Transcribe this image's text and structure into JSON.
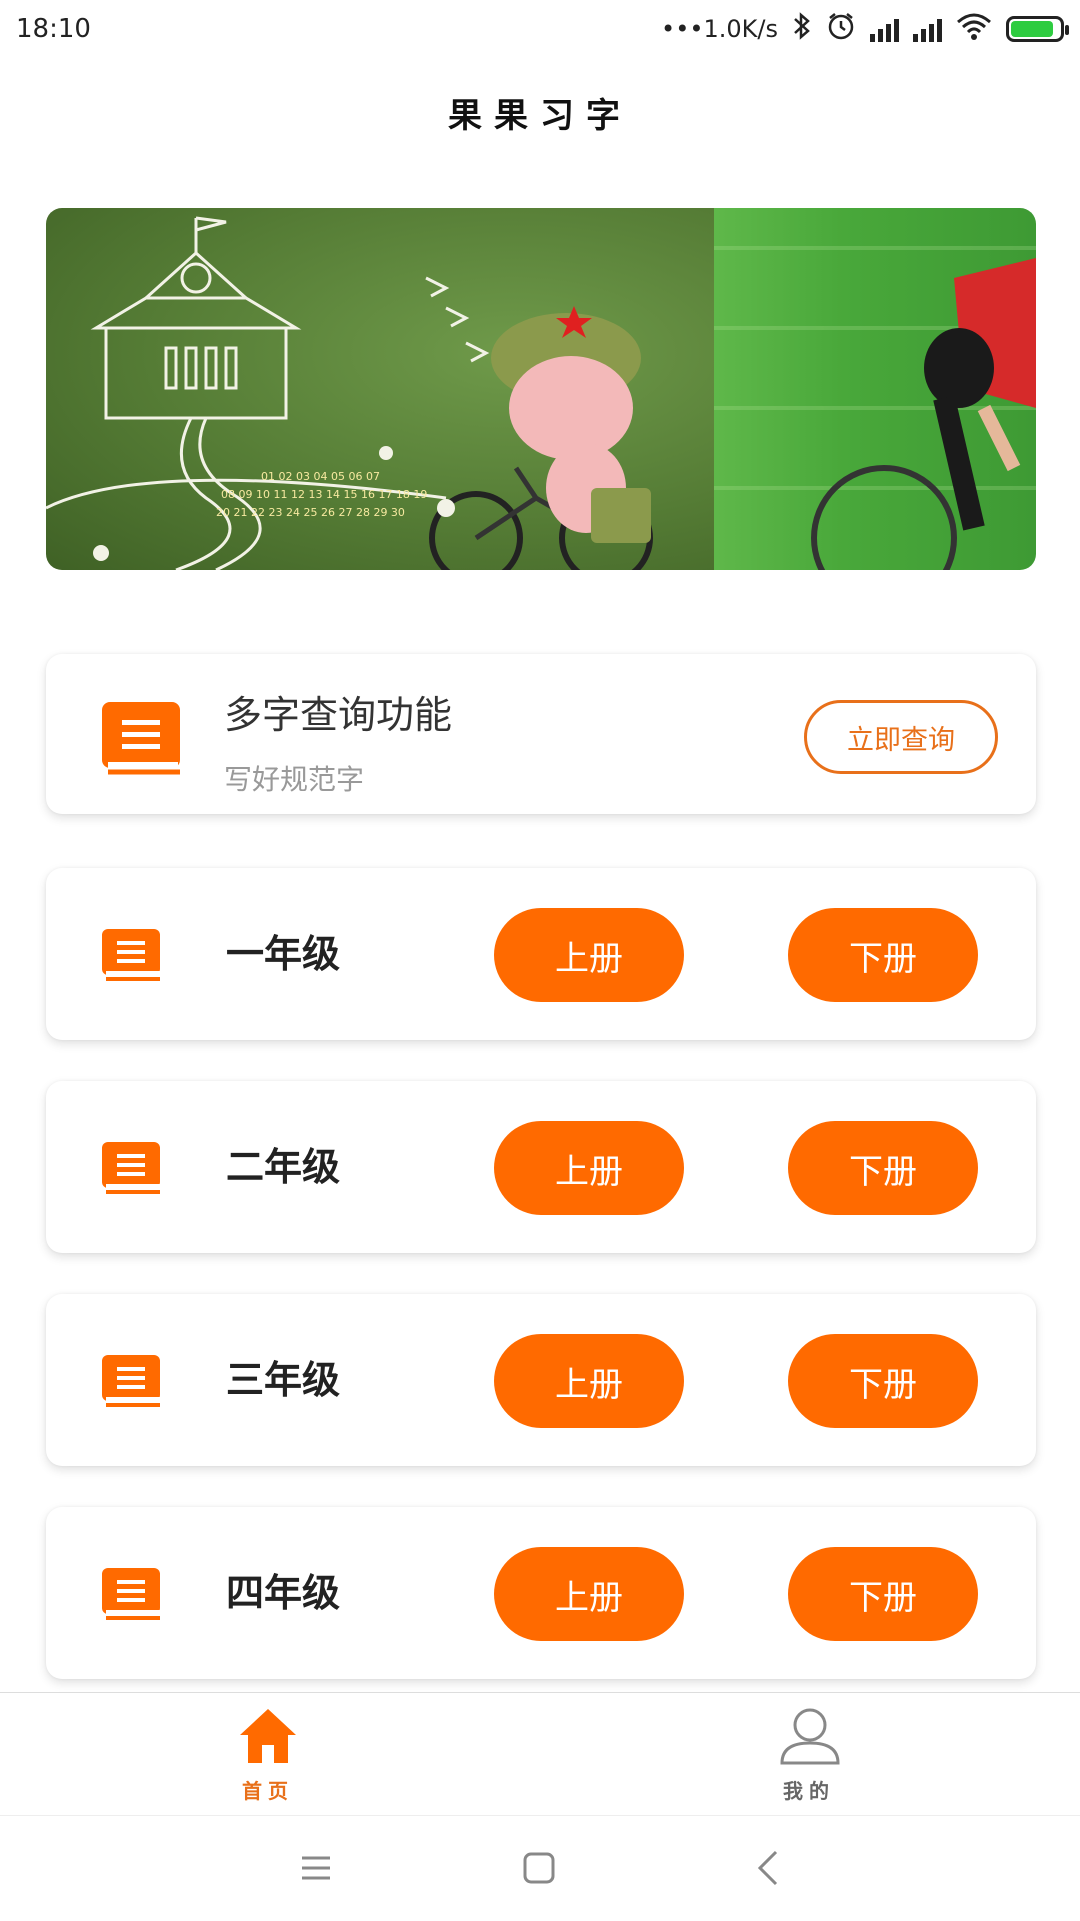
{
  "status_bar": {
    "time": "18:10",
    "network_speed": "•••1.0K/s",
    "icons": [
      "bluetooth-icon",
      "alarm-icon",
      "signal-icon",
      "signal-icon",
      "wifi-icon",
      "battery-charging-icon"
    ]
  },
  "app": {
    "title": "果果习字"
  },
  "colors": {
    "accent": "#ff6a00",
    "accent_outline": "#e8701a",
    "muted_text": "#999999"
  },
  "query_card": {
    "title": "多字查询功能",
    "subtitle": "写好规范字",
    "button_label": "立即查询",
    "icon": "book-icon"
  },
  "grades": [
    {
      "label": "一年级",
      "up_label": "上册",
      "down_label": "下册"
    },
    {
      "label": "二年级",
      "up_label": "上册",
      "down_label": "下册"
    },
    {
      "label": "三年级",
      "up_label": "上册",
      "down_label": "下册"
    },
    {
      "label": "四年级",
      "up_label": "上册",
      "down_label": "下册"
    }
  ],
  "bottom_nav": {
    "items": [
      {
        "label": "首页",
        "icon": "home-icon",
        "active": true
      },
      {
        "label": "我的",
        "icon": "person-icon",
        "active": false
      }
    ]
  },
  "system_nav": {
    "icons": [
      "menu-icon",
      "home-square-icon",
      "back-icon"
    ]
  }
}
